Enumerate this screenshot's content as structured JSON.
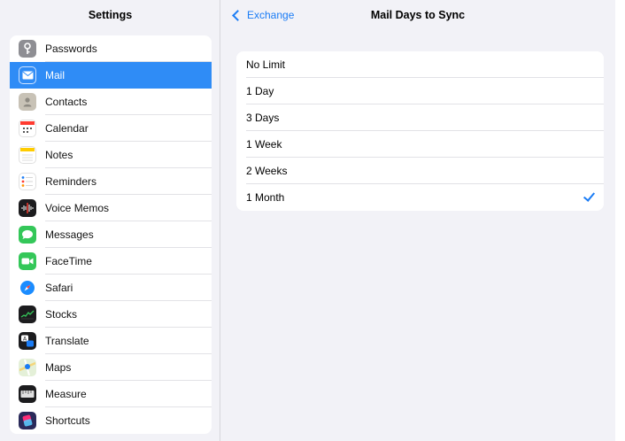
{
  "sidebar": {
    "title": "Settings",
    "items": [
      {
        "label": "Passwords",
        "icon": "key-icon",
        "color": "#8e8e93"
      },
      {
        "label": "Mail",
        "icon": "mail-icon",
        "color": "#2f8cf6"
      },
      {
        "label": "Contacts",
        "icon": "contacts-icon",
        "color": "#b9b2a6"
      },
      {
        "label": "Calendar",
        "icon": "calendar-icon",
        "color": "#ffffff"
      },
      {
        "label": "Notes",
        "icon": "notes-icon",
        "color": "#ffffff"
      },
      {
        "label": "Reminders",
        "icon": "reminders-icon",
        "color": "#ffffff"
      },
      {
        "label": "Voice Memos",
        "icon": "voice-memos-icon",
        "color": "#1c1c1e"
      },
      {
        "label": "Messages",
        "icon": "messages-icon",
        "color": "#34c759"
      },
      {
        "label": "FaceTime",
        "icon": "facetime-icon",
        "color": "#34c759"
      },
      {
        "label": "Safari",
        "icon": "safari-icon",
        "color": "#1a8cff"
      },
      {
        "label": "Stocks",
        "icon": "stocks-icon",
        "color": "#1c1c1e"
      },
      {
        "label": "Translate",
        "icon": "translate-icon",
        "color": "#1c1c1e"
      },
      {
        "label": "Maps",
        "icon": "maps-icon",
        "color": "#e8f2e0"
      },
      {
        "label": "Measure",
        "icon": "measure-icon",
        "color": "#1c1c1e"
      },
      {
        "label": "Shortcuts",
        "icon": "shortcuts-icon",
        "color": "#2a2a5a"
      }
    ],
    "selected": "Mail"
  },
  "detail": {
    "back_label": "Exchange",
    "title": "Mail Days to Sync",
    "options": [
      "No Limit",
      "1 Day",
      "3 Days",
      "1 Week",
      "2 Weeks",
      "1 Month"
    ],
    "selected_option": "1 Month"
  },
  "colors": {
    "accent": "#1a7cf5",
    "selection": "#2f8cf6",
    "background": "#f2f2f7"
  }
}
